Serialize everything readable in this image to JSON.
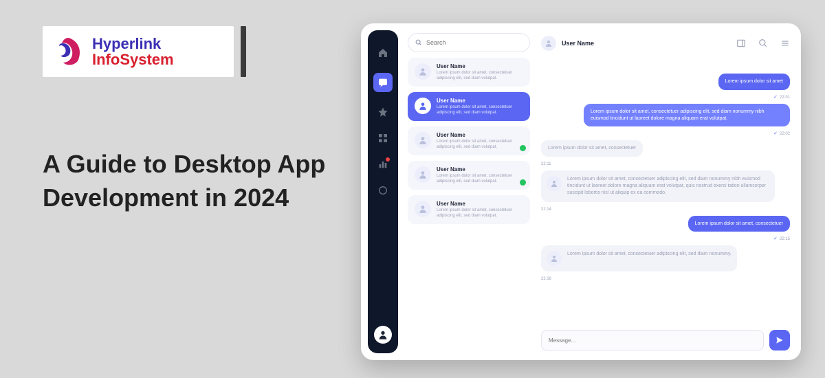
{
  "logo": {
    "line1": "Hyperlink",
    "line2": "InfoSystem"
  },
  "headline": "A Guide to Desktop App Development in 2024",
  "search": {
    "placeholder": "Search"
  },
  "contacts": [
    {
      "name": "User Name",
      "preview": "Lorem ipsum dolor sit amet, consectetuer adipiscing elit, sed diam volutpat."
    },
    {
      "name": "User Name",
      "preview": "Lorem ipsum dolor sit amet, consectetuer adipiscing elit, sed diam volutpat."
    },
    {
      "name": "User Name",
      "preview": "Lorem ipsum dolor sit amet, consectetuer adipiscing elit, sed diam volutpat."
    },
    {
      "name": "User Name",
      "preview": "Lorem ipsum dolor sit amet, consectetuer adipiscing elit, sed diam volutpat."
    },
    {
      "name": "User Name",
      "preview": "Lorem ipsum dolor sit amet, consectetuer adipiscing elit, sed diam volutpat."
    }
  ],
  "chat": {
    "header_name": "User Name",
    "messages": {
      "m1": "Lorem ipsum dolor sit amet",
      "t1": "22:01",
      "m2": "Lorem ipsum dolor sit amet, consectetuer adipiscing elit, sed diam nonummy nibh euismod tincidunt ut laoreet dolore magna aliquam erat volutpat.",
      "t2": "22:02",
      "m3": "Lorem ipsum dolor sit amet, consectetuer",
      "t3": "22:11",
      "m4": "Lorem ipsum dolor sit amet, consectetuer adipiscing elit, sed diam nonummy nibh euismod tincidunt ut laoreet dolore magna aliquam erat volutpat, quis nostrud exerci tation ullamcorper suscipit lobortis nisl ut aliquip ex ea commodo.",
      "t4": "22:14",
      "m5": "Lorem ipsum dolor sit amet, consectetuer",
      "t5": "22:15",
      "m6": "Lorem ipsum dolor sit amet, consectetuer adipiscing elit, sed diam nonummy.",
      "t6": "22:16"
    },
    "input_placeholder": "Message..."
  }
}
